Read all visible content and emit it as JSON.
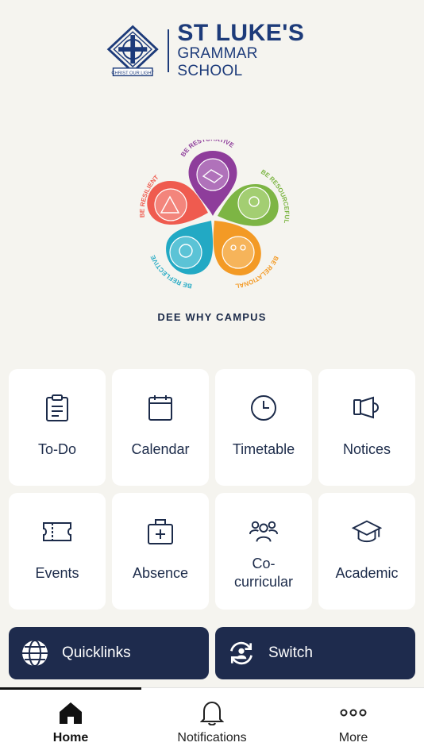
{
  "header": {
    "school_line1": "ST LUKE'S",
    "school_line2": "GRAMMAR SCHOOL",
    "crest_motto": "CHRIST OUR LIGHT",
    "brand_color": "#1d3b7a"
  },
  "values_graphic": {
    "items": [
      {
        "label": "BE RESTORATIVE",
        "color": "#8e3d9b",
        "icon": "handshake-icon"
      },
      {
        "label": "BE RESOURCEFUL",
        "color": "#7db544",
        "icon": "lightbulb-icon"
      },
      {
        "label": "BE RELATIONAL",
        "color": "#f39a25",
        "icon": "people-icon"
      },
      {
        "label": "BE REFLECTIVE",
        "color": "#22a9c4",
        "icon": "head-icon"
      },
      {
        "label": "BE RESILIENT",
        "color": "#ef5b4f",
        "icon": "mountain-icon"
      }
    ]
  },
  "campus": "DEE WHY CAMPUS",
  "tiles": [
    {
      "label": "To-Do",
      "icon": "clipboard-icon"
    },
    {
      "label": "Calendar",
      "icon": "calendar-icon"
    },
    {
      "label": "Timetable",
      "icon": "clock-icon"
    },
    {
      "label": "Notices",
      "icon": "megaphone-icon"
    },
    {
      "label": "Events",
      "icon": "ticket-icon"
    },
    {
      "label": "Absence",
      "icon": "first-aid-icon"
    },
    {
      "label": "Co-curricular",
      "line1": "Co-",
      "line2": "curricular",
      "icon": "group-icon"
    },
    {
      "label": "Academic",
      "icon": "graduation-cap-icon"
    }
  ],
  "actions": {
    "quicklinks": {
      "label": "Quicklinks",
      "icon": "globe-icon"
    },
    "switch": {
      "label": "Switch",
      "icon": "switch-user-icon"
    }
  },
  "tabbar": {
    "home": "Home",
    "notifications": "Notifications",
    "more": "More",
    "active": "home"
  },
  "colors": {
    "background": "#f5f4ef",
    "navy": "#1e2b4d",
    "tile": "#ffffff"
  }
}
